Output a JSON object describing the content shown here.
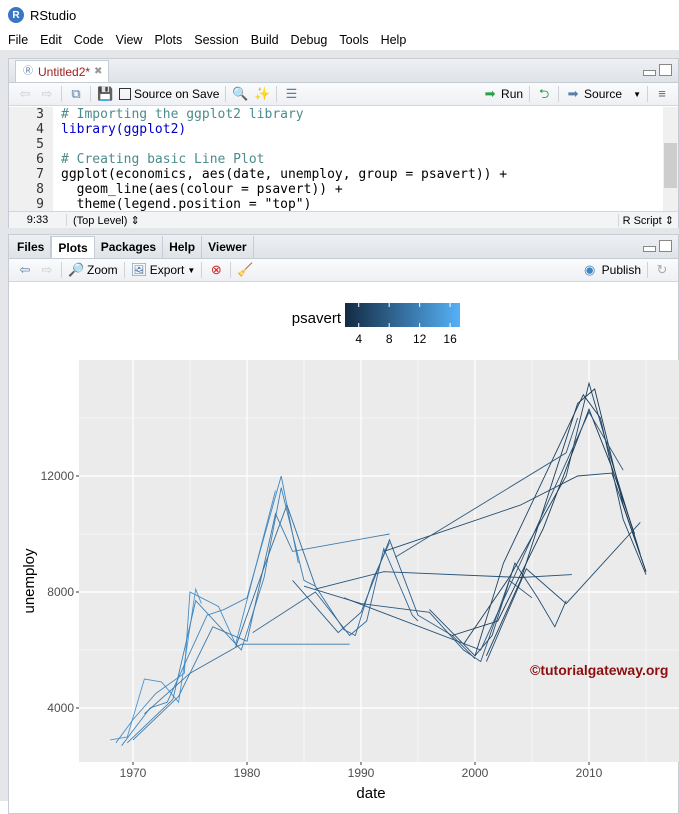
{
  "app": {
    "title": "RStudio",
    "logo": "R"
  },
  "menu": [
    "File",
    "Edit",
    "Code",
    "View",
    "Plots",
    "Session",
    "Build",
    "Debug",
    "Tools",
    "Help"
  ],
  "editor": {
    "tab_label": "Untitled2*",
    "source_on_save": "Source on Save",
    "run_label": "Run",
    "source_label": "Source",
    "lines": [
      {
        "n": "3",
        "html": "comment",
        "text": "# Importing the ggplot2 library"
      },
      {
        "n": "4",
        "html": "lib",
        "text": "library(ggplot2)"
      },
      {
        "n": "5",
        "html": "plain",
        "text": ""
      },
      {
        "n": "6",
        "html": "comment",
        "text": "# Creating basic Line Plot"
      },
      {
        "n": "7",
        "html": "plain",
        "text": "ggplot(economics, aes(date, unemploy, group = psavert)) +"
      },
      {
        "n": "8",
        "html": "plain",
        "text": "  geom_line(aes(colour = psavert)) +"
      },
      {
        "n": "9",
        "html": "plain",
        "text": "  theme(legend.position = \"top\")"
      }
    ],
    "cursor": "9:33",
    "scope": "(Top Level)",
    "filetype": "R Script"
  },
  "plots_pane": {
    "tabs": [
      "Files",
      "Plots",
      "Packages",
      "Help",
      "Viewer"
    ],
    "active_tab": "Plots",
    "zoom_label": "Zoom",
    "export_label": "Export",
    "publish_label": "Publish"
  },
  "watermark": "©tutorialgateway.org",
  "chart_data": {
    "type": "line",
    "xlabel": "date",
    "ylabel": "unemploy",
    "xlim": [
      1965.2,
      2017.5
    ],
    "ylim": [
      1900,
      15500
    ],
    "xticks": [
      "1970",
      "1980",
      "1990",
      "2000",
      "2010"
    ],
    "yticks": [
      "4000",
      "8000",
      "12000"
    ],
    "legend": {
      "title": "psavert",
      "position": "top",
      "ticks": [
        "4",
        "8",
        "12",
        "16"
      ],
      "range": [
        2.2,
        17.3
      ],
      "low": "#132B43",
      "high": "#56B1F7"
    },
    "series": [
      {
        "psavert": 14.5,
        "points": [
          [
            1968,
            2900
          ],
          [
            1969.5,
            3000
          ],
          [
            1971,
            5000
          ],
          [
            1972.5,
            4900
          ],
          [
            1974,
            4200
          ],
          [
            1975.5,
            8100
          ],
          [
            1976,
            7600
          ]
        ]
      },
      {
        "psavert": 13.5,
        "points": [
          [
            1968.5,
            2800
          ],
          [
            1970,
            3600
          ],
          [
            1972,
            4500
          ],
          [
            1974.5,
            5200
          ],
          [
            1975,
            8000
          ],
          [
            1977.5,
            7500
          ],
          [
            1979,
            6200
          ],
          [
            1982.5,
            11500
          ]
        ]
      },
      {
        "psavert": 12.5,
        "points": [
          [
            1969,
            2700
          ],
          [
            1971.5,
            4000
          ],
          [
            1973,
            4200
          ],
          [
            1976.5,
            7200
          ],
          [
            1978,
            7400
          ],
          [
            1980,
            7800
          ],
          [
            1983,
            12000
          ],
          [
            1984.5,
            9000
          ]
        ]
      },
      {
        "psavert": 11.8,
        "points": [
          [
            1969.5,
            2800
          ],
          [
            1973.5,
            4300
          ],
          [
            1975.5,
            7700
          ],
          [
            1979.5,
            6000
          ],
          [
            1981.5,
            8500
          ],
          [
            1983,
            11600
          ],
          [
            1985,
            8400
          ],
          [
            1986,
            8200
          ]
        ]
      },
      {
        "psavert": 11,
        "points": [
          [
            1970,
            2900
          ],
          [
            1974,
            4400
          ],
          [
            1977,
            6800
          ],
          [
            1980,
            6300
          ],
          [
            1982.5,
            10700
          ],
          [
            1984,
            9400
          ],
          [
            1992.5,
            10000
          ]
        ]
      },
      {
        "psavert": 10.5,
        "points": [
          [
            1971,
            3800
          ],
          [
            1975,
            5200
          ],
          [
            1979.5,
            6200
          ],
          [
            1989,
            6200
          ]
        ]
      },
      {
        "psavert": 9.5,
        "points": [
          [
            1979,
            6100
          ],
          [
            1982,
            9400
          ],
          [
            1983.5,
            11000
          ],
          [
            1986,
            8200
          ],
          [
            1988.5,
            6700
          ],
          [
            1989.5,
            6500
          ],
          [
            1991,
            8400
          ],
          [
            1992.5,
            9700
          ]
        ]
      },
      {
        "psavert": 9,
        "points": [
          [
            1980.5,
            6600
          ],
          [
            1986,
            8000
          ],
          [
            1989,
            6500
          ],
          [
            1990.5,
            7000
          ],
          [
            1992,
            9500
          ],
          [
            1994.5,
            7200
          ],
          [
            1995,
            7000
          ]
        ]
      },
      {
        "psavert": 8.2,
        "points": [
          [
            1984,
            8400
          ],
          [
            1988,
            6600
          ],
          [
            1990,
            7300
          ],
          [
            1992.5,
            9800
          ],
          [
            1995,
            7200
          ],
          [
            1998,
            6500
          ],
          [
            2000,
            5700
          ]
        ]
      },
      {
        "psavert": 7.3,
        "points": [
          [
            1985,
            8200
          ],
          [
            1990,
            7600
          ],
          [
            1996,
            7300
          ],
          [
            1999,
            6000
          ],
          [
            2000.5,
            5600
          ],
          [
            2003,
            8400
          ],
          [
            2005,
            7800
          ]
        ]
      },
      {
        "psavert": 6.5,
        "points": [
          [
            1986,
            8100
          ],
          [
            1992,
            8700
          ],
          [
            2004,
            8500
          ],
          [
            2008.5,
            8600
          ]
        ]
      },
      {
        "psavert": 6,
        "points": [
          [
            1996,
            7400
          ],
          [
            2000,
            5800
          ],
          [
            2001.5,
            6500
          ],
          [
            2003.5,
            9000
          ],
          [
            2005.5,
            7800
          ],
          [
            2007,
            6800
          ],
          [
            2008,
            7700
          ]
        ]
      },
      {
        "psavert": 5.5,
        "points": [
          [
            1992,
            9400
          ],
          [
            2004,
            11000
          ],
          [
            2009,
            12000
          ],
          [
            2012,
            12100
          ],
          [
            2015,
            8700
          ]
        ]
      },
      {
        "psavert": 5,
        "points": [
          [
            2000,
            5800
          ],
          [
            2002.5,
            9000
          ],
          [
            2009.5,
            14800
          ],
          [
            2011,
            14000
          ],
          [
            2013,
            10500
          ],
          [
            2015,
            8600
          ]
        ]
      },
      {
        "psavert": 4.5,
        "points": [
          [
            1999,
            6200
          ],
          [
            2003,
            8500
          ],
          [
            2008,
            12000
          ],
          [
            2010,
            15200
          ],
          [
            2012,
            12500
          ],
          [
            2014.5,
            9300
          ]
        ]
      },
      {
        "psavert": 4,
        "points": [
          [
            2001,
            5800
          ],
          [
            2004,
            8400
          ],
          [
            2009,
            14500
          ],
          [
            2010.5,
            15000
          ],
          [
            2013,
            11000
          ],
          [
            2015,
            8700
          ]
        ]
      },
      {
        "psavert": 3.5,
        "points": [
          [
            1998,
            6500
          ],
          [
            2002,
            7000
          ],
          [
            2006,
            10200
          ],
          [
            2010,
            14300
          ],
          [
            2012,
            12300
          ],
          [
            2014,
            10000
          ]
        ]
      },
      {
        "psavert": 6.8,
        "points": [
          [
            1988.5,
            7800
          ],
          [
            2000.5,
            6000
          ],
          [
            2010,
            14200
          ],
          [
            2013,
            12200
          ]
        ]
      },
      {
        "psavert": 7.8,
        "points": [
          [
            1993,
            9200
          ],
          [
            2008,
            12800
          ],
          [
            2009,
            14000
          ]
        ]
      },
      {
        "psavert": 5.8,
        "points": [
          [
            2001,
            5600
          ],
          [
            2004.5,
            8800
          ],
          [
            2008,
            7600
          ],
          [
            2014.5,
            10400
          ]
        ]
      }
    ]
  }
}
